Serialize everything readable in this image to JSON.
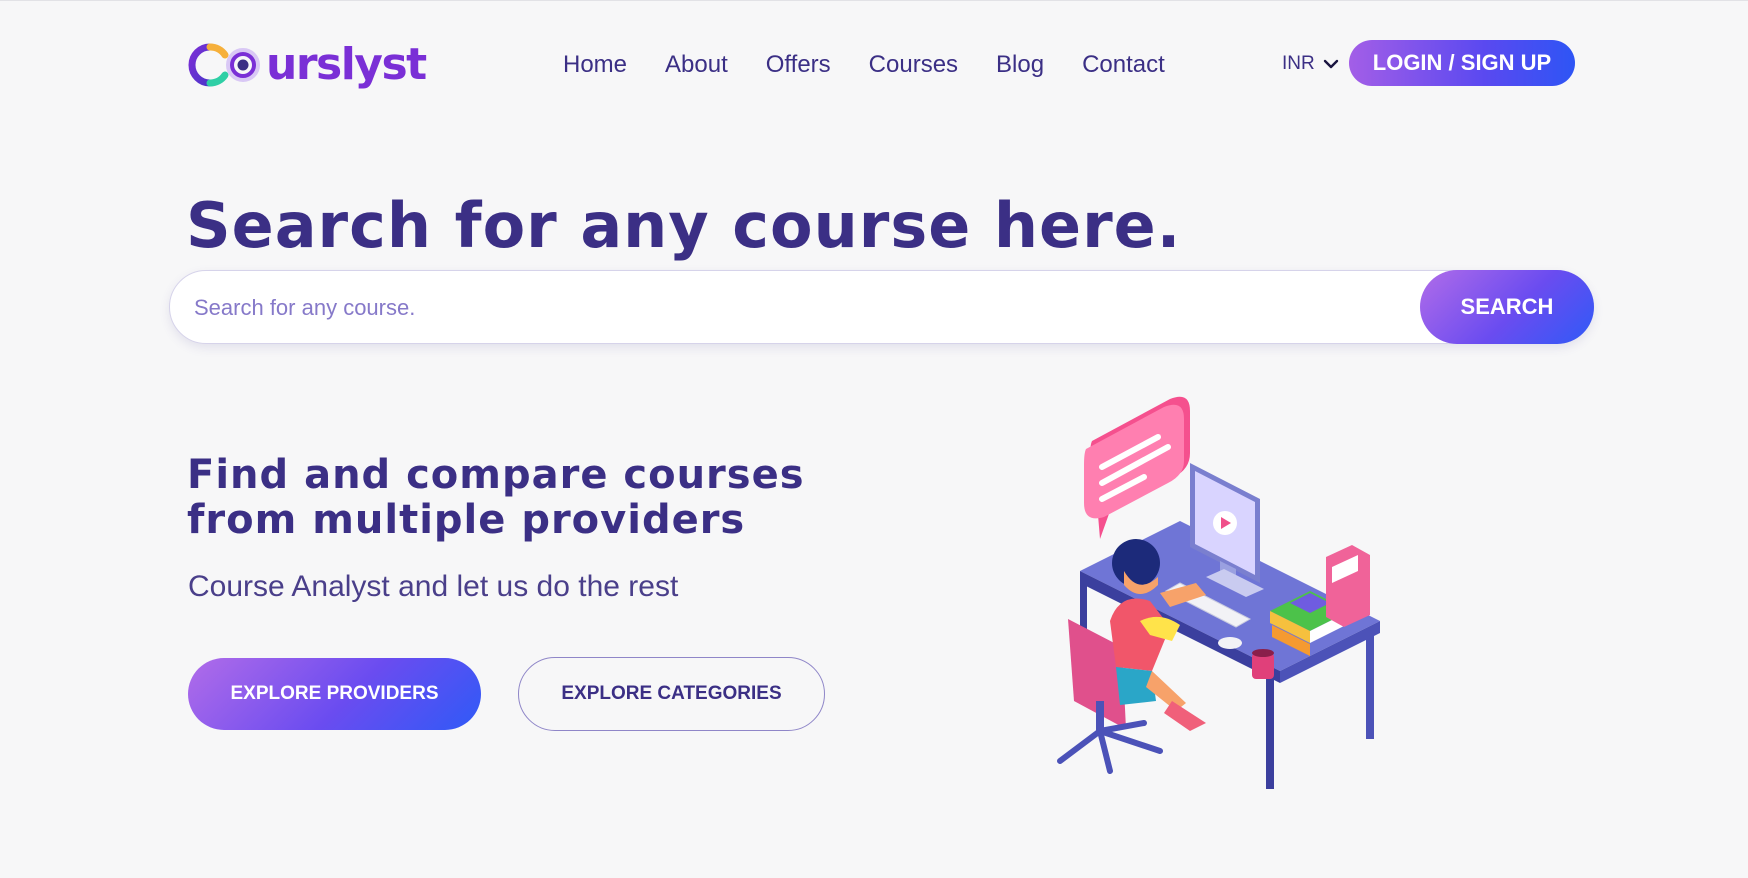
{
  "brand": {
    "name": "urslyst",
    "full_name": "Courslyst",
    "colors": {
      "primary": "#3b2f85",
      "accent_purple": "#a35ee7",
      "accent_blue": "#2e55f5",
      "logo": "#7a2fd6"
    }
  },
  "nav": {
    "items": [
      {
        "label": "Home"
      },
      {
        "label": "About"
      },
      {
        "label": "Offers"
      },
      {
        "label": "Courses"
      },
      {
        "label": "Blog"
      },
      {
        "label": "Contact"
      }
    ]
  },
  "currency": {
    "selected": "INR",
    "icon": "chevron-down-icon"
  },
  "login": {
    "label": "LOGIN / SIGN UP"
  },
  "hero": {
    "title": "Search for any course here.",
    "search": {
      "placeholder": "Search for any course.",
      "value": "",
      "button_label": "SEARCH"
    }
  },
  "intro": {
    "heading_line1": "Find and compare courses",
    "heading_line2": "from multiple providers",
    "tagline": "Course Analyst and let us do the rest",
    "primary_button": "EXPLORE PROVIDERS",
    "secondary_button": "EXPLORE CATEGORIES"
  },
  "illustration": {
    "icon": "student-at-desk-illustration"
  }
}
